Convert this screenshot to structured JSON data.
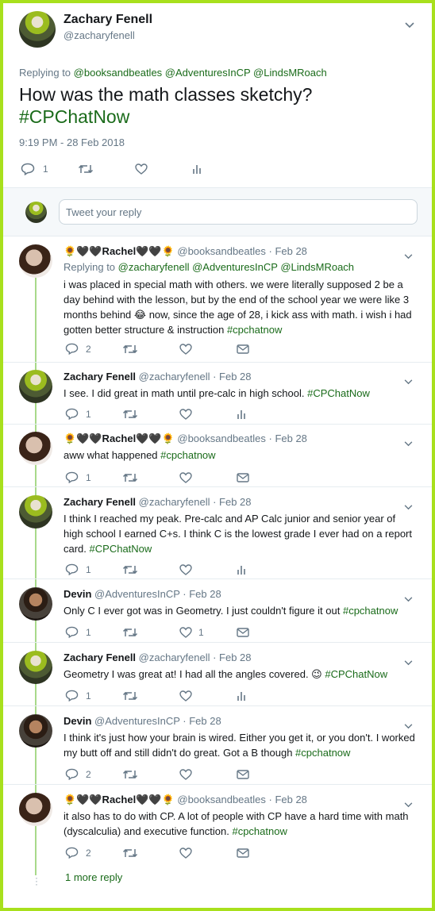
{
  "main_tweet": {
    "name": "Zachary Fenell",
    "handle": "@zacharyfenell",
    "replying_label": "Replying to",
    "replying_to": [
      "@booksandbeatles",
      "@AdventuresInCP",
      "@LindsMRoach"
    ],
    "text": "How was the math classes sketchy?",
    "hashtag": "#CPChatNow",
    "timestamp": "9:19 PM - 28 Feb 2018",
    "reply_count": "1"
  },
  "reply_box": {
    "placeholder": "Tweet your reply"
  },
  "replies": [
    {
      "name": "🌻🖤🖤Rachel🖤🖤🌻",
      "handle": "@booksandbeatles",
      "date": "· Feb 28",
      "replying_label": "Replying to",
      "replying_to": [
        "@zacharyfenell",
        "@AdventuresInCP",
        "@LindsMRoach"
      ],
      "text": "i was placed in special math with others. we were literally supposed 2 be a day behind with the lesson, but by the end of the school year we were like 3 months behind 😂 now, since the age of 28, i kick ass with math. i wish i had gotten better structure & instruction",
      "hashtag": "#cpchatnow",
      "reply_count": "2",
      "like_count": ""
    },
    {
      "name": "Zachary Fenell",
      "handle": "@zacharyfenell",
      "date": "· Feb 28",
      "text": "I see. I did great in math until pre-calc in high school.",
      "hashtag": "#CPChatNow",
      "reply_count": "1",
      "like_count": ""
    },
    {
      "name": "🌻🖤🖤Rachel🖤🖤🌻",
      "handle": "@booksandbeatles",
      "date": "· Feb 28",
      "text": "aww what happened",
      "hashtag": "#cpchatnow",
      "reply_count": "1",
      "like_count": ""
    },
    {
      "name": "Zachary Fenell",
      "handle": "@zacharyfenell",
      "date": "· Feb 28",
      "text": "I think I reached my peak. Pre-calc and AP Calc junior and senior year of high school I earned C+s. I think C is the lowest grade I ever had on a report card.",
      "hashtag": "#CPChatNow",
      "reply_count": "1",
      "like_count": ""
    },
    {
      "name": "Devin",
      "handle": "@AdventuresInCP",
      "date": "· Feb 28",
      "text": "Only C I ever got was in Geometry. I just couldn't figure it out",
      "hashtag": "#cpchatnow",
      "reply_count": "1",
      "like_count": "1"
    },
    {
      "name": "Zachary Fenell",
      "handle": "@zacharyfenell",
      "date": "· Feb 28",
      "text": "Geometry I was great at! I had all the angles covered. 😉",
      "hashtag": "#CPChatNow",
      "reply_count": "1",
      "like_count": ""
    },
    {
      "name": "Devin",
      "handle": "@AdventuresInCP",
      "date": "· Feb 28",
      "text": "I think it's just how your brain is wired. Either you get it, or you don't. I worked my butt off and still didn't do great. Got a B though",
      "hashtag": "#cpchatnow",
      "reply_count": "2",
      "like_count": ""
    },
    {
      "name": "🌻🖤🖤Rachel🖤🖤🌻",
      "handle": "@booksandbeatles",
      "date": "· Feb 28",
      "text": "it also has to do with CP. A lot of people with CP have a hard time with math (dyscalculia) and executive function.",
      "hashtag": "#cpchatnow",
      "reply_count": "2",
      "like_count": ""
    }
  ],
  "more_replies": "1 more reply",
  "colors": {
    "frame": "#a8e01c",
    "link": "#1a6b1a",
    "thread_line": "#a8d98a",
    "muted": "#657786"
  }
}
